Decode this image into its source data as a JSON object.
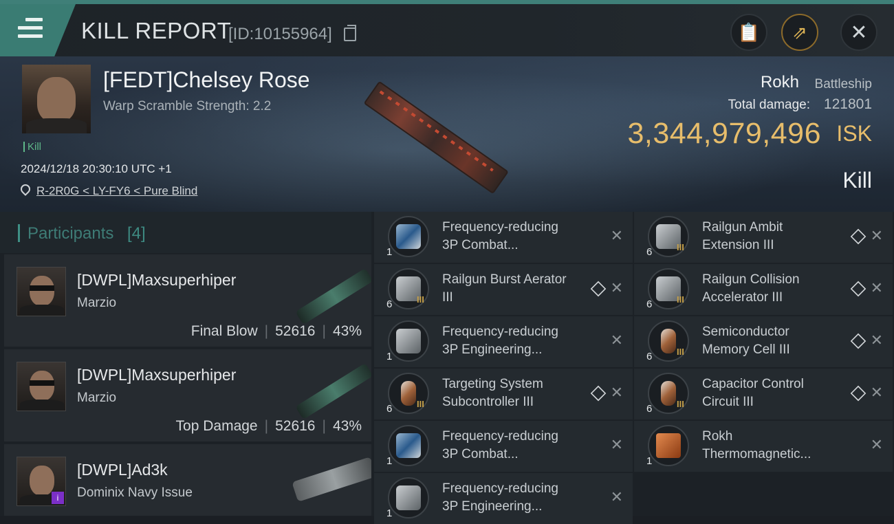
{
  "header": {
    "title": "KILL REPORT",
    "id_text": "[ID:10155964]",
    "buttons": [
      "clipboard-icon",
      "share-icon",
      "close-icon"
    ]
  },
  "victim": {
    "name": "[FEDT]Chelsey Rose",
    "warp_scramble": "Warp Scramble Strength: 2.2",
    "kill_tag": "Kill",
    "datetime": "2024/12/18 20:30:10 UTC +1",
    "location": "R-2R0G < LY-FY6 < Pure Blind",
    "ship_name": "Rokh",
    "ship_class": "Battleship",
    "total_damage_label": "Total damage:",
    "total_damage": "121801",
    "isk_value": "3,344,979,496",
    "isk_unit": "ISK",
    "result": "Kill"
  },
  "participants": {
    "title": "Participants",
    "count": "[4]",
    "list": [
      {
        "name": "[DWPL]Maxsuperhiper",
        "ship": "Marzio",
        "label": "Final Blow",
        "damage": "52616",
        "percent": "43%"
      },
      {
        "name": "[DWPL]Maxsuperhiper",
        "ship": "Marzio",
        "label": "Top Damage",
        "damage": "52616",
        "percent": "43%"
      },
      {
        "name": "[DWPL]Ad3k",
        "ship": "Dominix Navy Issue",
        "label": "",
        "damage": "",
        "percent": ""
      }
    ]
  },
  "items": {
    "left": [
      {
        "qty": "1",
        "name1": "Frequency-reducing",
        "name2": "3P Combat...",
        "stack": false
      },
      {
        "qty": "6",
        "name1": "Railgun Burst Aerator",
        "name2": "III",
        "stack": true
      },
      {
        "qty": "1",
        "name1": "Frequency-reducing",
        "name2": "3P Engineering...",
        "stack": false
      },
      {
        "qty": "6",
        "name1": "Targeting System",
        "name2": "Subcontroller III",
        "stack": true
      },
      {
        "qty": "1",
        "name1": "Frequency-reducing",
        "name2": "3P Combat...",
        "stack": false
      },
      {
        "qty": "1",
        "name1": "Frequency-reducing",
        "name2": "3P Engineering...",
        "stack": false
      }
    ],
    "right": [
      {
        "qty": "6",
        "name1": "Railgun Ambit",
        "name2": "Extension III",
        "stack": true
      },
      {
        "qty": "6",
        "name1": "Railgun Collision",
        "name2": "Accelerator III",
        "stack": true
      },
      {
        "qty": "6",
        "name1": "Semiconductor",
        "name2": "Memory Cell III",
        "stack": true
      },
      {
        "qty": "6",
        "name1": "Capacitor Control",
        "name2": "Circuit III",
        "stack": true
      },
      {
        "qty": "1",
        "name1": "Rokh",
        "name2": "Thermomagnetic...",
        "stack": false
      }
    ]
  },
  "colors": {
    "accent": "#3f7f78",
    "isk": "#e7bd6b",
    "kill_tag": "#5fb98a"
  }
}
